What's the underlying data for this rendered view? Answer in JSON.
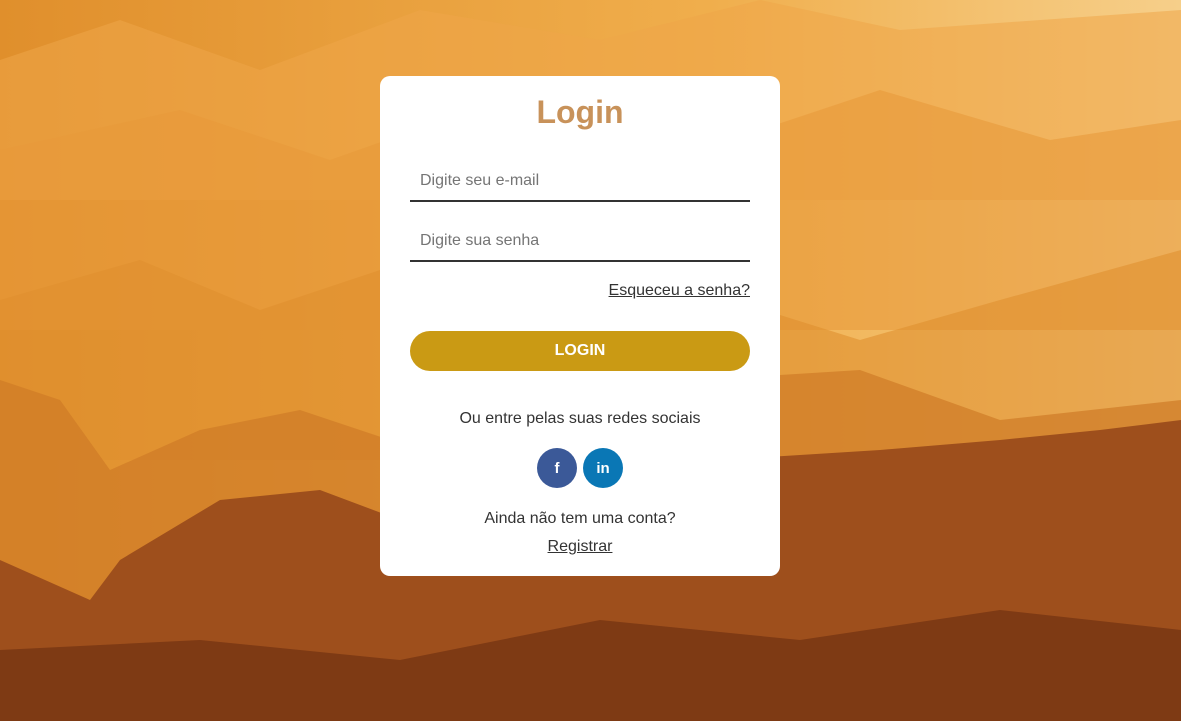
{
  "login": {
    "title": "Login",
    "email_placeholder": "Digite seu e-mail",
    "password_placeholder": "Digite sua senha",
    "forgot_password": "Esqueceu a senha?",
    "login_button": "LOGIN",
    "social_text": "Ou entre pelas suas redes sociais",
    "social": [
      {
        "icon": "facebook-icon",
        "glyph": "f",
        "color": "#3b5998"
      },
      {
        "icon": "linkedin-icon",
        "glyph": "in",
        "color": "#0a77b5"
      }
    ],
    "no_account_text": "Ainda não tem uma conta?",
    "register_link": "Registrar"
  },
  "colors": {
    "title": "#c8925a",
    "button": "#ca9a14"
  }
}
